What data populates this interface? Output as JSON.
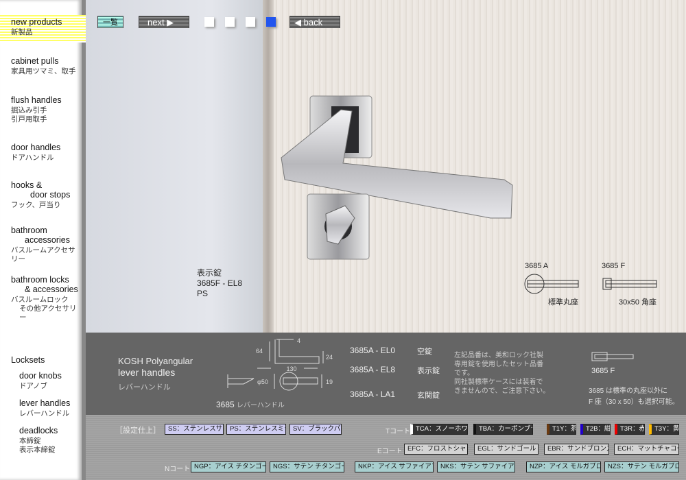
{
  "sidebar": {
    "items": [
      {
        "en": "new products",
        "jp": "新製品",
        "active": true
      },
      {
        "en": "cabinet pulls",
        "jp": "家具用ツマミ、取手"
      },
      {
        "en": "flush handles",
        "jp": "掘込み引手",
        "jp2": "引戸用取手"
      },
      {
        "en": "door handles",
        "jp": "ドアハンドル"
      },
      {
        "en": "hooks &",
        "en2": "door stops",
        "jp": "フック、戸当り"
      },
      {
        "en": "bathroom",
        "en2": "accessories",
        "jp": "バスルームアクセサリー"
      },
      {
        "en": "bathroom locks",
        "en2": "& accessories",
        "jp": "バスルームロック",
        "jp2": "その他アクセサリー"
      },
      {
        "en": "Locksets"
      },
      {
        "en": "door knobs",
        "jp": "ドアノブ"
      },
      {
        "en": "lever handles",
        "jp": "レバーハンドル"
      },
      {
        "en": "deadlocks",
        "jp": "本締錠",
        "jp2": "表示本締錠"
      }
    ]
  },
  "nav": {
    "list": "一覧",
    "next": "next",
    "back": "back",
    "pages": 4,
    "current_page": 4,
    "current_color": "#2255ee"
  },
  "photo": {
    "caption_type": "表示錠",
    "caption_model": "3685F - EL8",
    "caption_finish": "PS",
    "rose_a_label": "3685 A",
    "rose_a_desc": "標準丸座",
    "rose_f_label": "3685 F",
    "rose_f_desc": "30x50 角座"
  },
  "product": {
    "title1": "KOSH  Polyangular",
    "title2": "lever handles",
    "title_jp": "レバーハンドル",
    "dims": {
      "h": "64",
      "t": "4",
      "w": "130",
      "d": "24",
      "rose": "φ50",
      "r": "19"
    },
    "drawing_caption_num": "3685",
    "drawing_caption_jp": "レバーハンドル",
    "models": [
      {
        "code": "3685A - EL0",
        "type": "空錠"
      },
      {
        "code": "3685A - EL8",
        "type": "表示錠"
      },
      {
        "code": "3685A - LA1",
        "type": "玄関錠"
      }
    ],
    "note": [
      "左記品番は、美和ロック社製",
      "専用錠を使用したセット品番",
      "です。",
      "同社製標準ケースには装着で",
      "きませんので、ご注意下さい。"
    ],
    "f_label": "3685 F",
    "f_note1": "3685 は標準の丸座以外に",
    "f_note2": "F 座（30 x 50）も選択可能。"
  },
  "finishes": {
    "label": "［設定仕上］",
    "standard": [
      "SS：ステンレスサテン",
      "PS：ステンレスミラー",
      "SV：ブラックパール"
    ],
    "t_label": "Tコート",
    "t": [
      {
        "t": "TCA：スノーホワイト",
        "c": "#ffffff"
      },
      {
        "t": "TBA：カーボンブラック",
        "c": "#111111"
      },
      {
        "t": "T1Y：茶",
        "c": "#6b3a10"
      },
      {
        "t": "T2B：紺",
        "c": "#2200cc"
      },
      {
        "t": "T3R：赤",
        "c": "#ee0000"
      },
      {
        "t": "T3Y：黄",
        "c": "#ffbb00"
      }
    ],
    "e_label": "Eコート",
    "e": [
      "EFC：フロストシャンパン",
      "EGL：サンドゴールド",
      "EBR：サンドブロンズ",
      "ECH：マットチャコール"
    ],
    "n_label": "Nコート",
    "n": [
      "NGP：アイス チタンゴールド",
      "NGS：サテン チタンゴールド",
      "NKP：アイス サファイアブラック",
      "NKS：サテン サファイアブラック",
      "NZP：アイス モルガブロンズ",
      "NZS：サテン モルガブロンズ"
    ]
  }
}
